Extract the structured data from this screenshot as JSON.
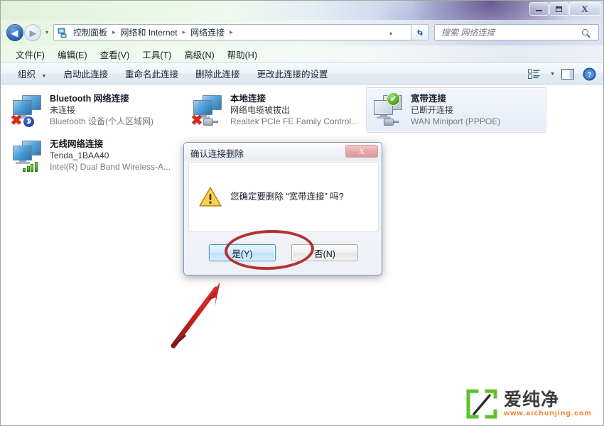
{
  "window": {
    "caption_buttons": {
      "minimize_label": "–",
      "maximize_label": "□",
      "close_label": "X"
    }
  },
  "navbar": {
    "back_glyph": "◀",
    "forward_glyph": "▶",
    "history_glyph": "▾",
    "address_dropdown_glyph": "▾",
    "refresh_glyph": "↺",
    "breadcrumbs": [
      {
        "label": "控制面板"
      },
      {
        "label": "网络和 Internet"
      },
      {
        "label": "网络连接"
      }
    ],
    "breadcrumb_separator": "▸",
    "address_icon": "network-folder-icon",
    "search": {
      "placeholder": "搜索 网络连接",
      "value": "",
      "icon": "search-icon"
    }
  },
  "menubar": {
    "items": [
      {
        "label": "文件(F)"
      },
      {
        "label": "编辑(E)"
      },
      {
        "label": "查看(V)"
      },
      {
        "label": "工具(T)"
      },
      {
        "label": "高级(N)"
      },
      {
        "label": "帮助(H)"
      }
    ]
  },
  "toolbar": {
    "organize_label": "组织",
    "organize_caret": "▼",
    "items": [
      {
        "label": "启动此连接"
      },
      {
        "label": "重命名此连接"
      },
      {
        "label": "删除此连接"
      },
      {
        "label": "更改此连接的设置"
      }
    ],
    "view_icon": "view-options-icon",
    "view_caret": "▼",
    "preview_icon": "preview-pane-icon",
    "help_icon": "help-icon",
    "help_glyph": "?"
  },
  "connections": [
    {
      "name": "Bluetooth 网络连接",
      "status": "未连接",
      "device": "Bluetooth 设备(个人区域网)",
      "icon": "network-adapter-icon",
      "badge": "red-x-icon",
      "badge_glyph": "✖",
      "sub_badge": "bluetooth-icon",
      "sub_badge_glyph": "ᛦ",
      "selected": false
    },
    {
      "name": "本地连接",
      "status": "网络电缆被拔出",
      "device": "Realtek PCIe FE Family Control...",
      "icon": "network-adapter-icon",
      "badge": "red-x-icon",
      "badge_glyph": "✖",
      "sub_badge": "unplugged-cable-icon",
      "selected": false
    },
    {
      "name": "宽带连接",
      "status": "已断开连接",
      "device": "WAN Miniport (PPPOE)",
      "icon": "network-adapter-icon",
      "badge": "green-check-icon",
      "badge_glyph": "✔",
      "sub_badge": "modem-icon",
      "selected": true
    },
    {
      "name": "无线网络连接",
      "status": "Tenda_1BAA40",
      "device": "Intel(R) Dual Band Wireless-A...",
      "icon": "network-adapter-icon",
      "badge": "none",
      "sub_badge": "signal-bars-icon",
      "selected": false
    }
  ],
  "dialog": {
    "title": "确认连接删除",
    "close_label": "X",
    "warning_icon": "warning-triangle-icon",
    "message": "您确定要删除 “宽带连接” 吗?",
    "buttons": [
      {
        "label": "是(Y)",
        "kind": "default"
      },
      {
        "label": "否(N)",
        "kind": "normal"
      }
    ]
  },
  "annotations": {
    "ellipse_color": "#b53232",
    "arrow_color": "#cc2222",
    "ellipse_target": "yes-button",
    "arrow_target": "confirm-dialog"
  },
  "watermark": {
    "logo": "aichunjing-logo",
    "brand": "爱纯净",
    "url": "www.aichunjing.com",
    "brand_color": "#3c3c3c",
    "url_color": "#ef7d1a",
    "logo_color": "#5ec12a"
  }
}
